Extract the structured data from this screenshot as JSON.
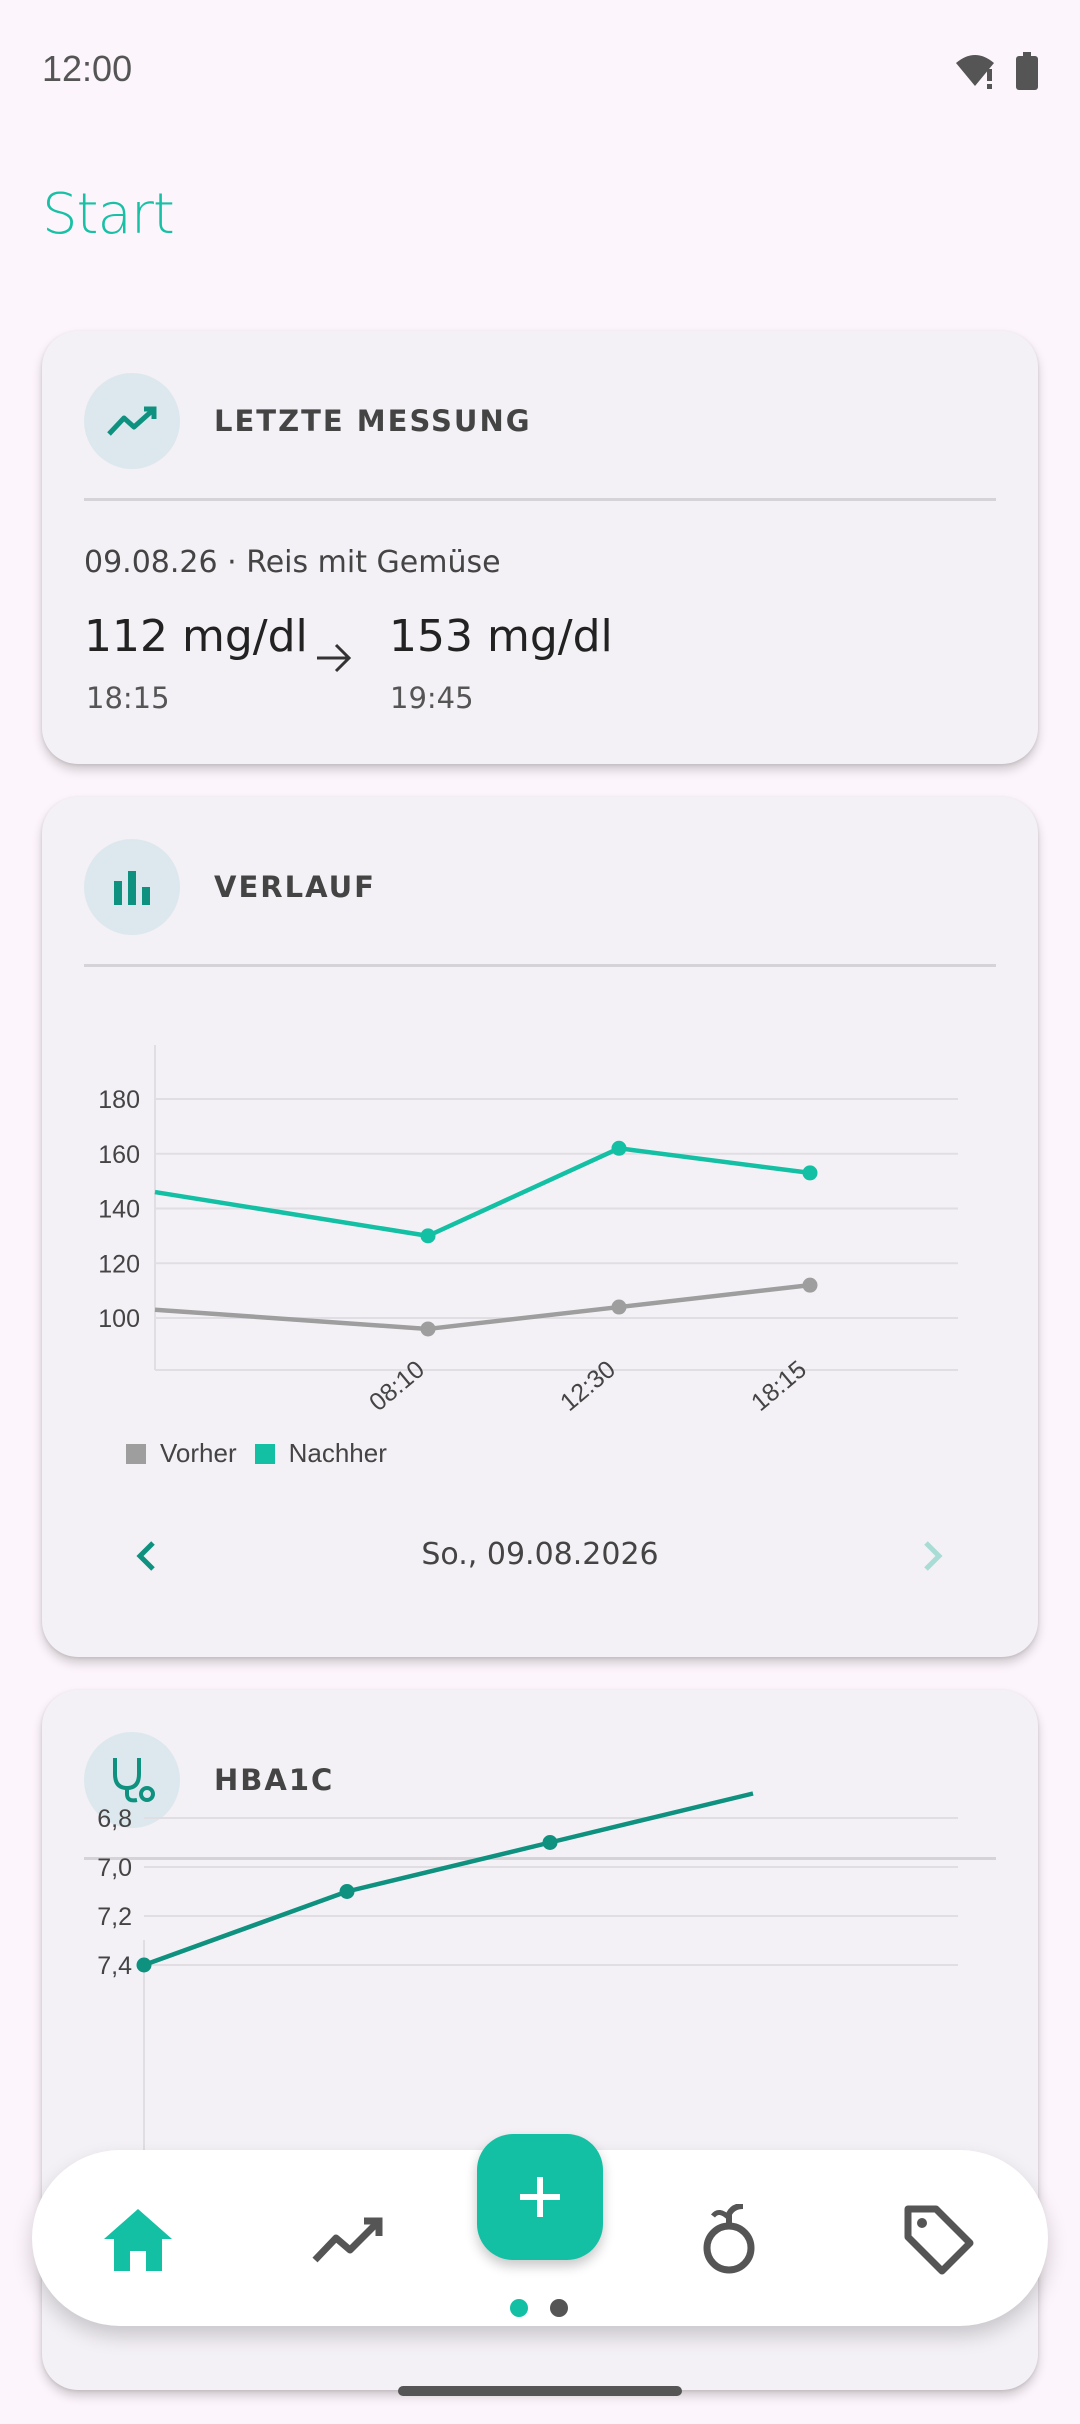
{
  "status_bar": {
    "time": "12:00",
    "icons": [
      "wifi-warning-icon",
      "battery-icon"
    ]
  },
  "page": {
    "title": "Start"
  },
  "last_measurement": {
    "icon": "trend-line-icon",
    "title": "LETZTE MESSUNG",
    "meta": "09.08.26 · Reis mit Gemüse",
    "before": {
      "value": "112 mg/dl",
      "time": "18:15"
    },
    "after": {
      "value": "153 mg/dl",
      "time": "19:45"
    }
  },
  "history": {
    "icon": "bar-chart-icon",
    "title": "VERLAUF",
    "date_label": "So., 09.08.2026",
    "legend": {
      "before": "Vorher",
      "after": "Nachher"
    }
  },
  "hba1c": {
    "icon": "stethoscope-icon",
    "title": "HBA1C"
  },
  "bottom_nav": {
    "items": [
      "home-icon",
      "trend-line-icon",
      "apple-icon",
      "tag-icon"
    ],
    "fab_icon": "plus-icon",
    "active_index": 0,
    "page_dots": 2,
    "active_dot": 0
  },
  "colors": {
    "accent": "#13c0a4",
    "accent_dark": "#0f9180",
    "before": "#9e9e9e",
    "background": "#fcf5fb",
    "card": "#f4f1f6"
  },
  "chart_data": [
    {
      "type": "line",
      "title": "",
      "xlabel": "",
      "ylabel": "",
      "x": [
        "08:10",
        "12:30",
        "18:15"
      ],
      "ylim": [
        90,
        195
      ],
      "yticks": [
        100,
        120,
        140,
        160,
        180
      ],
      "grid": true,
      "legend_position": "bottom-left",
      "series": [
        {
          "name": "Vorher",
          "color": "#9e9e9e",
          "values": [
            96,
            104,
            112
          ],
          "incoming_value": 103
        },
        {
          "name": "Nachher",
          "color": "#13c0a4",
          "values": [
            130,
            162,
            153
          ],
          "incoming_value": 146
        }
      ]
    },
    {
      "type": "line",
      "title": "",
      "xlabel": "",
      "ylabel": "",
      "yticks": [
        "7,4",
        "7,2",
        "7,0",
        "6,8"
      ],
      "ytick_values": [
        7.4,
        7.2,
        7.0,
        6.8
      ],
      "grid": true,
      "series": [
        {
          "name": "",
          "color": "#0f9180",
          "values": [
            7.4,
            7.1,
            6.9,
            6.7
          ]
        }
      ]
    }
  ]
}
